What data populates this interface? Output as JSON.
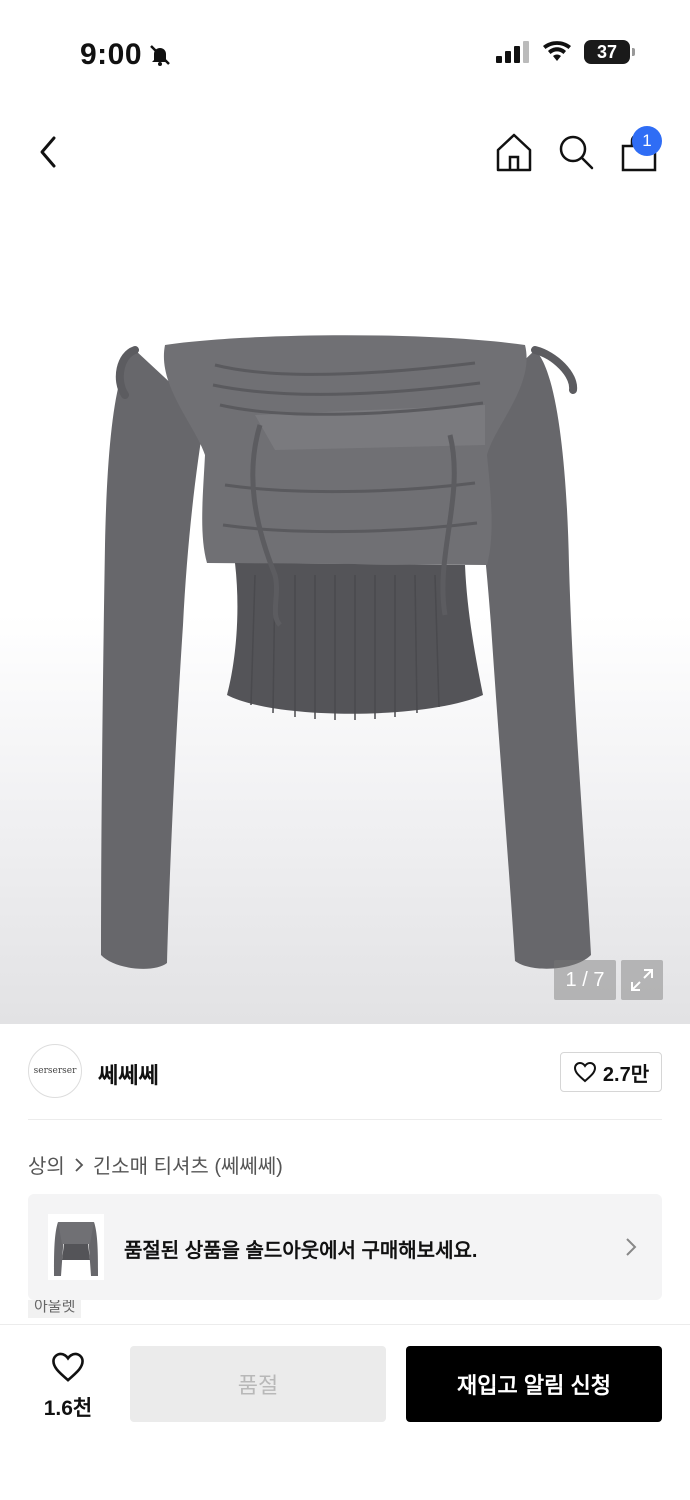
{
  "status_bar": {
    "time": "9:00",
    "battery": "37",
    "icons": [
      "bell-slash-icon",
      "cellular-signal-icon",
      "wifi-icon",
      "battery-icon"
    ]
  },
  "header": {
    "icons": [
      "back-arrow-icon",
      "home-icon",
      "search-icon",
      "shopping-bag-icon"
    ],
    "cart_count": "1"
  },
  "gallery": {
    "pager": "1 / 7",
    "zoom_icon": "expand-icon"
  },
  "brand": {
    "logo_text": "serserser",
    "name": "쎄쎄쎄",
    "likes": "2.7만"
  },
  "breadcrumb": {
    "category": "상의",
    "subcategory": "긴소매 티셔츠 (쎄쎄쎄)"
  },
  "soldout_banner": {
    "text": "품절된 상품을 솔드아웃에서 구매해보세요."
  },
  "outlet_tag": "아울렛",
  "bottom_bar": {
    "wish_count": "1.6천",
    "soldout_label": "품절",
    "restock_label": "재입고 알림 신청"
  },
  "colors": {
    "accent_badge": "#2f6df5",
    "primary_button": "#000000",
    "disabled_button": "#ebebeb",
    "garment": "#6b6b6f"
  }
}
